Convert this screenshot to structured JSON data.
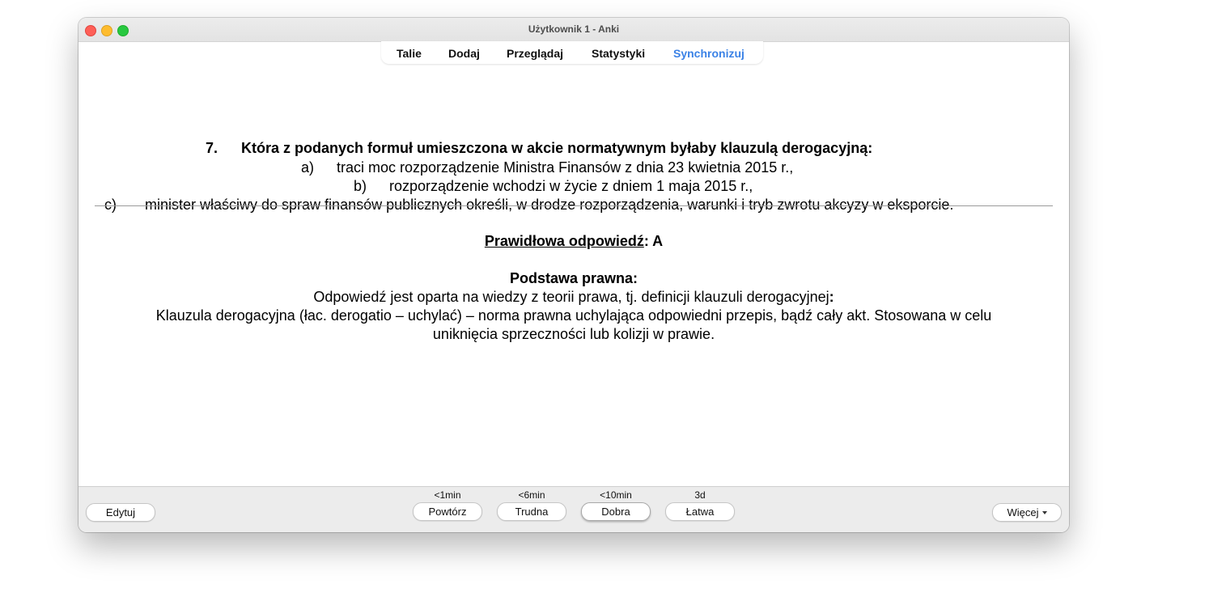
{
  "window": {
    "title": "Użytkownik 1 - Anki"
  },
  "toolbar": {
    "items": [
      "Talie",
      "Dodaj",
      "Przeglądaj",
      "Statystyki",
      "Synchronizuj"
    ]
  },
  "card": {
    "question": {
      "number": "7.",
      "text": "Która z podanych formuł umieszczona w akcie normatywnym byłaby klauzulą derogacyjną:",
      "options": [
        {
          "label": "a)",
          "text": "traci moc rozporządzenie Ministra Finansów z dnia 23 kwietnia 2015 r.,"
        },
        {
          "label": "b)",
          "text": "rozporządzenie wchodzi w życie z dniem 1 maja 2015 r.,"
        },
        {
          "label": "c)",
          "text": "minister właściwy do spraw finansów publicznych określi, w drodze rozporządzenia, warunki i tryb zwrotu akcyzy w eksporcie."
        }
      ]
    },
    "answer": {
      "correct_label": "Prawidłowa odpowiedź",
      "correct_value": ": A",
      "basis_heading": "Podstawa prawna:",
      "basis_intro": "Odpowiedź jest oparta na wiedzy z teorii prawa, tj. definicji klauzuli derogacyjnej",
      "basis_intro_colon": ":",
      "definition_line1": "Klauzula derogacyjna (łac. derogatio – uchylać) – norma prawna uchylająca odpowiedni przepis, bądź cały akt. Stosowana w celu",
      "definition_line2": "uniknięcia sprzeczności lub kolizji w prawie."
    }
  },
  "bottombar": {
    "edit_label": "Edytuj",
    "more_label": "Więcej",
    "answers": [
      {
        "interval": "<1min",
        "label": "Powtórz"
      },
      {
        "interval": "<6min",
        "label": "Trudna"
      },
      {
        "interval": "<10min",
        "label": "Dobra"
      },
      {
        "interval": "3d",
        "label": "Łatwa"
      }
    ]
  },
  "colors": {
    "sync_accent": "#3b82e6",
    "close": "#fe5f57",
    "minimize": "#febc2e",
    "maximize": "#28c840"
  }
}
